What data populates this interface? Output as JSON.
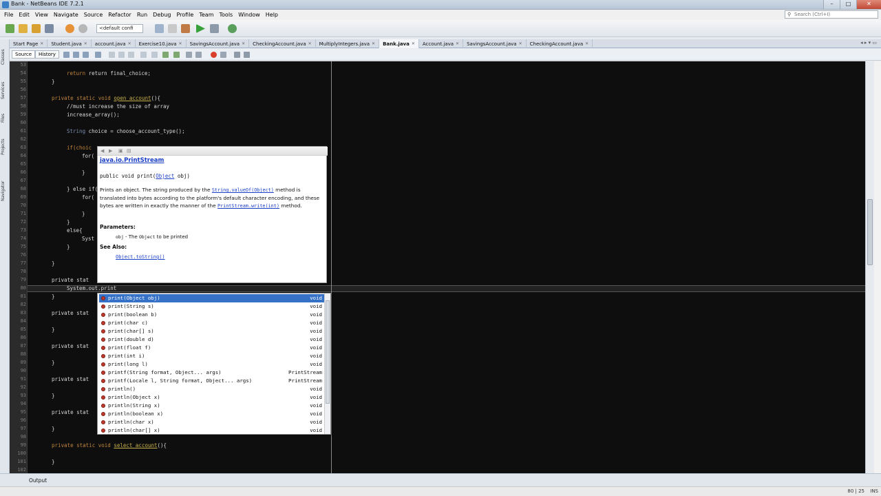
{
  "window": {
    "title": "Bank - NetBeans IDE 7.2.1",
    "controls": [
      "–",
      "□",
      "✕"
    ]
  },
  "menu": [
    "File",
    "Edit",
    "View",
    "Navigate",
    "Source",
    "Refactor",
    "Run",
    "Debug",
    "Profile",
    "Team",
    "Tools",
    "Window",
    "Help"
  ],
  "search": {
    "placeholder": "Search (Ctrl+I)"
  },
  "toolbar": {
    "config_value": "<default confi"
  },
  "tabs": [
    {
      "label": "Start Page",
      "active": false
    },
    {
      "label": "Student.java",
      "active": false
    },
    {
      "label": "account.java",
      "active": false
    },
    {
      "label": "Exercise10.java",
      "active": false
    },
    {
      "label": "SavingsAccount.java",
      "active": false
    },
    {
      "label": "CheckingAccount.java",
      "active": false
    },
    {
      "label": "MultiplyIntegers.java",
      "active": false
    },
    {
      "label": "Bank.java",
      "active": true
    },
    {
      "label": "Account.java",
      "active": false
    },
    {
      "label": "SavingsAccount.java",
      "active": false
    },
    {
      "label": "CheckingAccount.java",
      "active": false
    }
  ],
  "editor_toolbar": {
    "source_label": "Source",
    "history_label": "History"
  },
  "side_tabs": [
    "Classes",
    "Services",
    "Files",
    "Projects",
    "Navigator"
  ],
  "line_numbers": [
    "53",
    "54",
    "55",
    "56",
    "57",
    "58",
    "59",
    "60",
    "61",
    "62",
    "63",
    "64",
    "65",
    "66",
    "67",
    "68",
    "69",
    "70",
    "71",
    "72",
    "73",
    "74",
    "75",
    "76",
    "77",
    "78",
    "79",
    "80",
    "81",
    "82",
    "83",
    "84",
    "85",
    "86",
    "87",
    "88",
    "89",
    "90",
    "91",
    "92",
    "93",
    "94",
    "95",
    "96",
    "97",
    "98",
    "99",
    "100",
    "101",
    "102"
  ],
  "code": {
    "l53": "return final_choice;",
    "l55": "}",
    "l57_kw": "private static void",
    "l57_fn": "open_account",
    "l57_tail": "(){",
    "l58": "//must increase the size of array",
    "l59": "increase_array();",
    "l61_ty": "String",
    "l61_rest": "choice = choose_account_type();",
    "l63": "if(choic",
    "l64": "for(",
    "l66": "}",
    "l67": "} else if(",
    "l68": "for(",
    "l70": "}",
    "l71": "}",
    "l72": "else{",
    "l73": "Syst",
    "l74": "}",
    "l76": "}",
    "l78_kw": "private stat",
    "l79": "System.out.print",
    "l80": "}",
    "l82": "private stat",
    "l84": "}",
    "l86": "private stat",
    "l88": "}",
    "l90": "private stat",
    "l92": "}",
    "l94": "private stat",
    "l96": "}",
    "l98_kw": "private static void",
    "l98_fn": "select_account",
    "l98_tail": "(){",
    "l100": "}"
  },
  "javadoc": {
    "class": "java.io.PrintStream",
    "sig_prefix": "public void print(",
    "sig_type": "Object",
    "sig_suffix": " obj)",
    "desc_1": "Prints an object. The string produced by the ",
    "desc_link1": "String.valueOf(Object)",
    "desc_2": " method is translated into bytes according to the platform's default character encoding, and these bytes are written in exactly the manner of the ",
    "desc_link2": "PrintStream.write(int)",
    "desc_3": " method.",
    "params_heading": "Parameters:",
    "param_name": "obj",
    "param_dash": " - The ",
    "param_type": "Object",
    "param_desc": " to be printed",
    "see_heading": "See Also:",
    "see_link": "Object.toString()"
  },
  "completion": [
    {
      "sig": "print(Object obj)",
      "ret": "void",
      "selected": true
    },
    {
      "sig": "print(String s)",
      "ret": "void"
    },
    {
      "sig": "print(boolean b)",
      "ret": "void"
    },
    {
      "sig": "print(char c)",
      "ret": "void"
    },
    {
      "sig": "print(char[] s)",
      "ret": "void"
    },
    {
      "sig": "print(double d)",
      "ret": "void"
    },
    {
      "sig": "print(float f)",
      "ret": "void"
    },
    {
      "sig": "print(int i)",
      "ret": "void"
    },
    {
      "sig": "print(long l)",
      "ret": "void"
    },
    {
      "sig": "printf(String format, Object... args)",
      "ret": "PrintStream"
    },
    {
      "sig": "printf(Locale l, String format, Object... args)",
      "ret": "PrintStream"
    },
    {
      "sig": "println()",
      "ret": "void"
    },
    {
      "sig": "println(Object x)",
      "ret": "void"
    },
    {
      "sig": "println(String x)",
      "ret": "void"
    },
    {
      "sig": "println(boolean x)",
      "ret": "void"
    },
    {
      "sig": "println(char x)",
      "ret": "void"
    },
    {
      "sig": "println(char[] x)",
      "ret": "void"
    }
  ],
  "bottom": {
    "output_label": "Output"
  },
  "status": {
    "position": "80 | 25",
    "mode": "INS"
  },
  "colors": {
    "editor_bg": "#0e0e0e",
    "keyword": "#c2853d",
    "comment": "#5e5e5e",
    "selection": "#3471c7",
    "link": "#1a3ec7"
  }
}
